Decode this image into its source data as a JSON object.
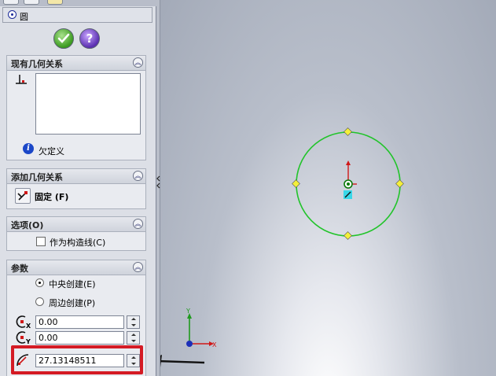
{
  "feature": {
    "title": "圆",
    "ok_icon": "check-icon",
    "help_icon": "question-icon",
    "help_glyph": "?"
  },
  "existing_relations": {
    "header": "现有几何关系",
    "status_text": "欠定义"
  },
  "add_relations": {
    "header": "添加几何关系",
    "fix_label": "固定 (F)"
  },
  "options": {
    "header": "选项(O)",
    "construction_label": "作为构造线(C)",
    "construction_checked": false
  },
  "parameters": {
    "header": "参数",
    "center_create_label": "中央创建(E)",
    "perimeter_create_label": "周边创建(P)",
    "selected_mode": "center",
    "center_x": "0.00",
    "center_y": "0.00",
    "radius": "27.13148511"
  },
  "axis": {
    "x_label": "X",
    "y_label": "Y"
  },
  "colors": {
    "circle": "#21c42a",
    "highlight_box": "#d41b24",
    "origin_x": "#d01818",
    "origin_y": "#1f9a1f",
    "origin_center": "#1c2fb8",
    "endpoint": "#f4ef3a"
  }
}
